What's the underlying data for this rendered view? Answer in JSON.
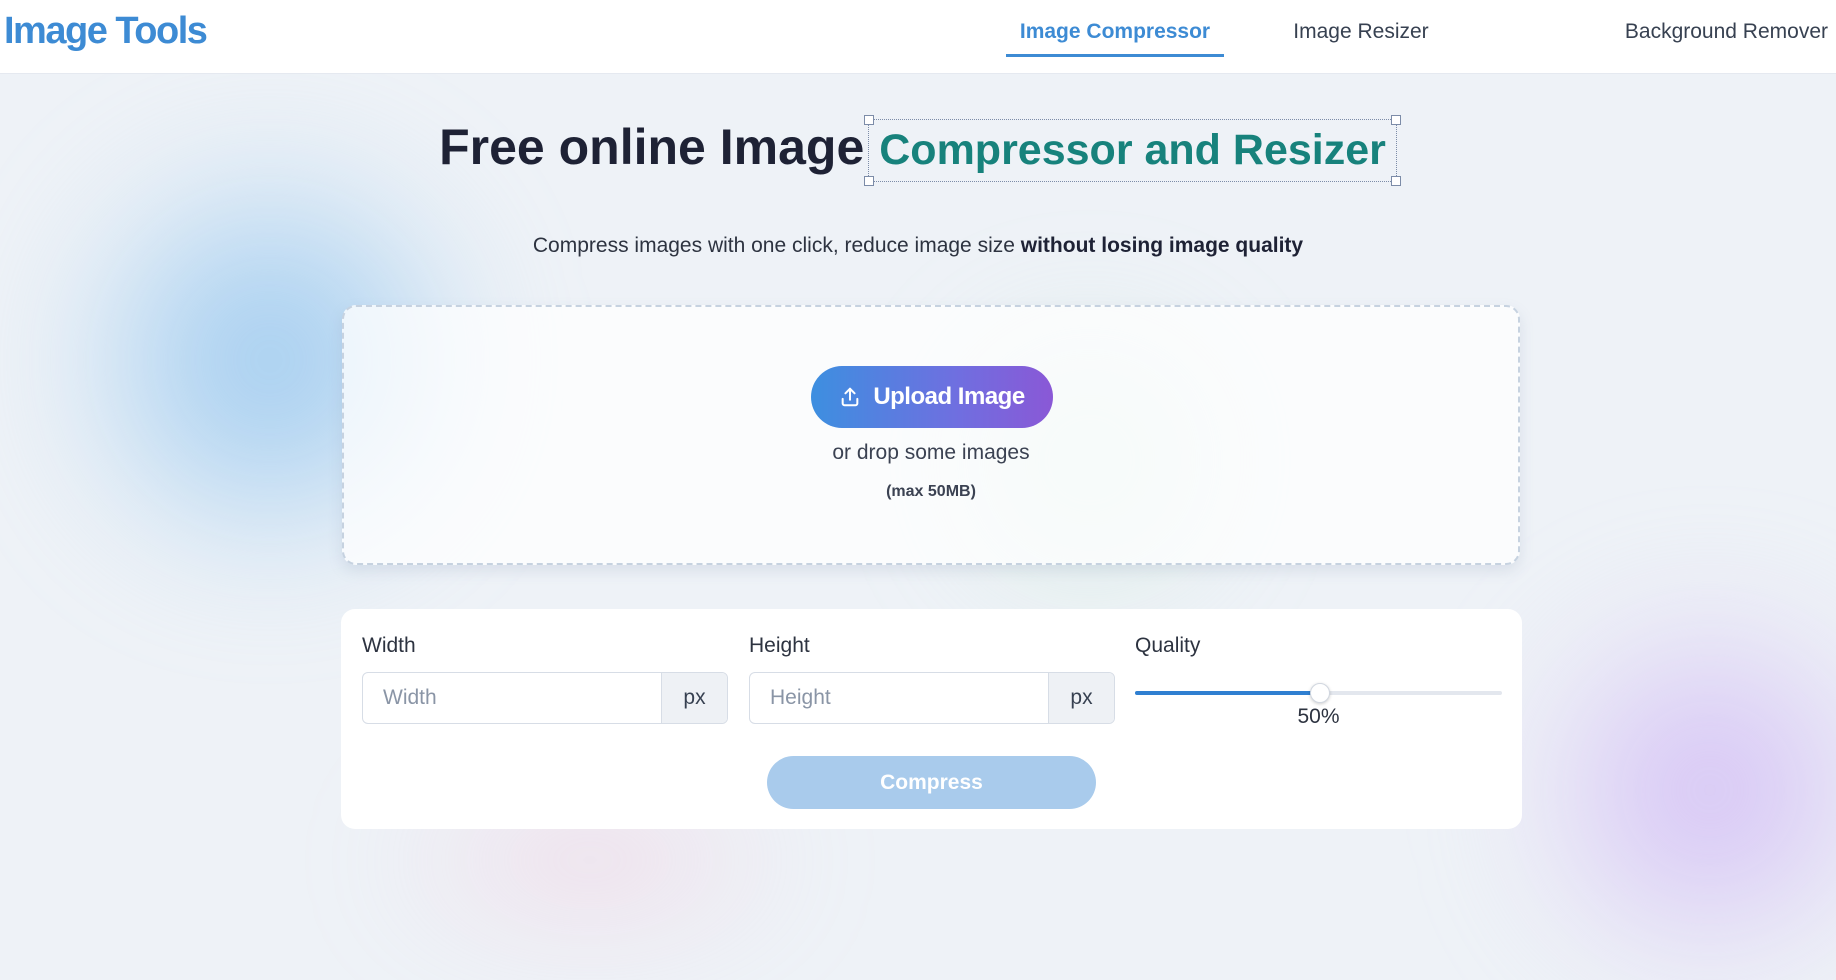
{
  "header": {
    "logo": "Image Tools",
    "nav": [
      {
        "label": "Image Compressor",
        "active": true
      },
      {
        "label": "Image Resizer",
        "active": false
      },
      {
        "label": "Background Remover",
        "active": false
      }
    ]
  },
  "hero": {
    "title_plain": "Free online Image",
    "title_accent": "Compressor and Resizer",
    "subtitle_plain": "Compress images with one click, reduce image size ",
    "subtitle_bold": "without losing image quality"
  },
  "dropzone": {
    "upload_label": "Upload Image",
    "upload_icon": "upload-icon",
    "drop_text": "or drop some images",
    "max_text": "(max 50MB)"
  },
  "options": {
    "width": {
      "label": "Width",
      "placeholder": "Width",
      "value": "",
      "unit": "px"
    },
    "height": {
      "label": "Height",
      "placeholder": "Height",
      "value": "",
      "unit": "px"
    },
    "quality": {
      "label": "Quality",
      "value": 50,
      "display": "50%"
    },
    "compress_label": "Compress"
  },
  "colors": {
    "brand": "#3d8bd4",
    "accent": "#17827c",
    "compress_disabled": "#a9cbec",
    "upload_gradient_start": "#3d8fe0",
    "upload_gradient_end": "#8a58d6"
  }
}
